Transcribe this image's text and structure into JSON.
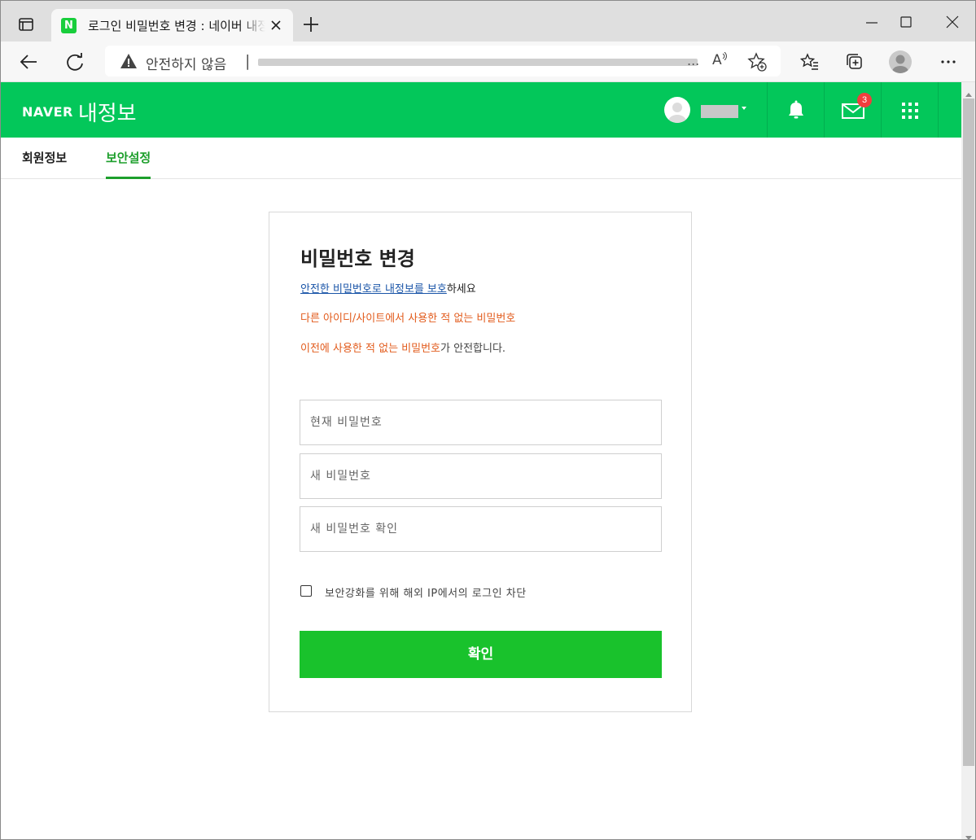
{
  "browser": {
    "tab": {
      "favicon_letter": "N",
      "title": "로그인 비밀번호 변경 : 네이버 내정보"
    },
    "address_bar": {
      "security_text": "안전하지 않음",
      "separator": "|",
      "url_ellipsis": "..."
    },
    "read_aloud_label": "A"
  },
  "header": {
    "brand_naver": "NAVER",
    "brand_sub": "내정보",
    "mail_badge": "3",
    "colors": {
      "brand_green": "#03c75a",
      "badge_red": "#f03e3e"
    }
  },
  "subnav": {
    "tabs": [
      {
        "label": "회원정보",
        "active": false
      },
      {
        "label": "보안설정",
        "active": true
      }
    ]
  },
  "card": {
    "title": "비밀번호 변경",
    "link_text": "안전한 비밀번호로 내정보를 보호",
    "link_suffix": "하세요",
    "warning_line1": "다른 아이디/사이트에서 사용한 적 없는 비밀번호",
    "warning_line2_highlight": "이전에 사용한 적 없는 비밀번호",
    "warning_line2_suffix": "가 안전합니다.",
    "fields": {
      "current_password_placeholder": "현재 비밀번호",
      "new_password_placeholder": "새 비밀번호",
      "confirm_password_placeholder": "새 비밀번호 확인"
    },
    "block_foreign_ip": {
      "label": "보안강화를 위해 해외 IP에서의 로그인 차단",
      "checked": false
    },
    "submit_label": "확인",
    "colors": {
      "submit_green": "#19c22c",
      "warning_orange": "#e25b1c",
      "link_blue": "#1a55a8"
    }
  }
}
